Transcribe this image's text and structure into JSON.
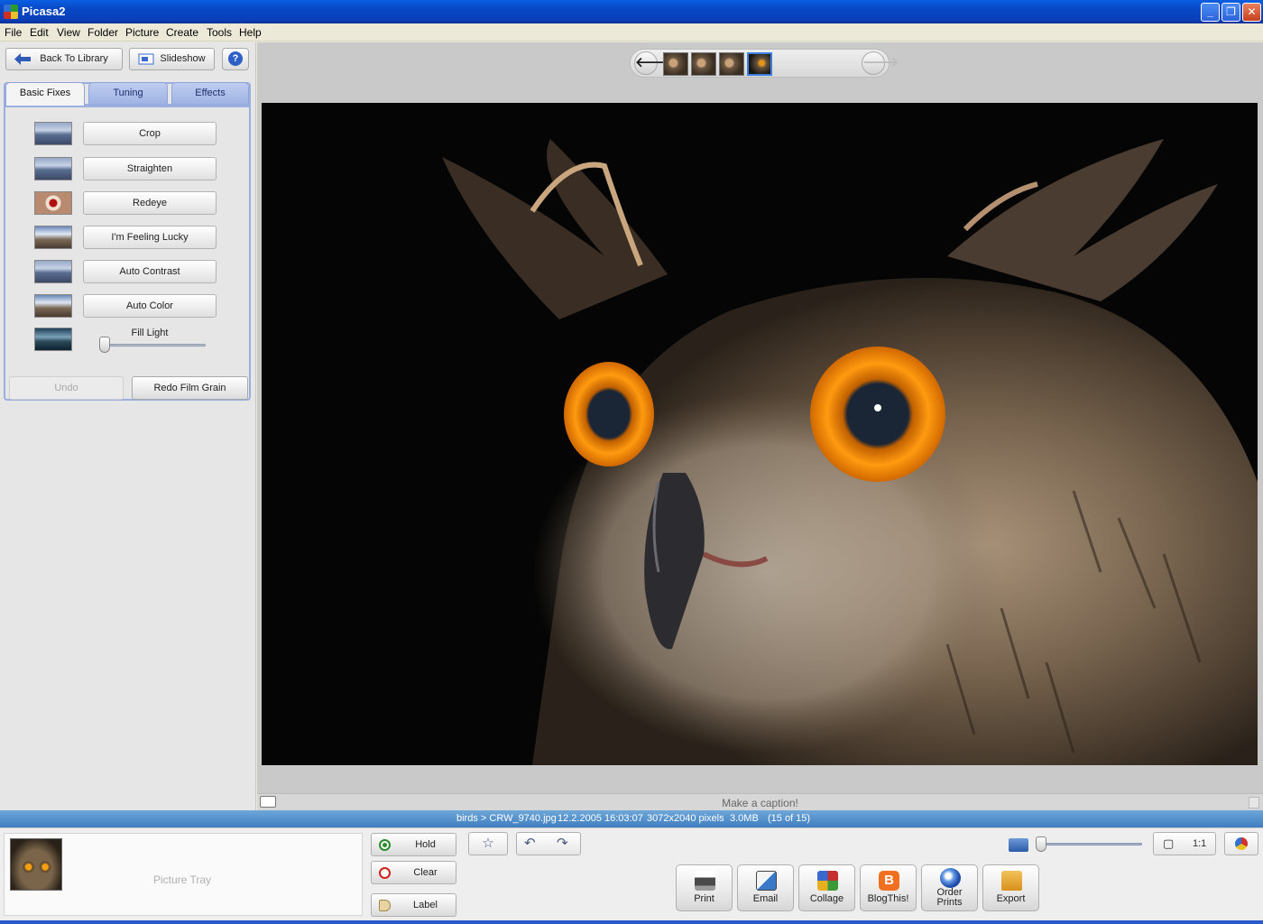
{
  "window": {
    "title": "Picasa2",
    "minimize": "_",
    "restore": "❐",
    "close": "✕"
  },
  "menu": [
    "File",
    "Edit",
    "View",
    "Folder",
    "Picture",
    "Create",
    "Tools",
    "Help"
  ],
  "leftpanel": {
    "back_label": "Back To Library",
    "slideshow_label": "Slideshow",
    "help_label": "?",
    "tabs": [
      "Basic Fixes",
      "Tuning",
      "Effects"
    ],
    "active_tab": "Basic Fixes",
    "fixes": [
      "Crop",
      "Straighten",
      "Redeye",
      "I'm Feeling Lucky",
      "Auto Contrast",
      "Auto Color"
    ],
    "fill_light_label": "Fill Light",
    "fill_light_value": 0,
    "undo_label": "Undo",
    "redo_label": "Redo Film Grain"
  },
  "filmstrip": {
    "prev": "🡐",
    "next": "🡒",
    "thumbnail_count": 4,
    "selected_index": 3
  },
  "caption": {
    "placeholder": "Make a caption!"
  },
  "status": {
    "path": "birds > CRW_9740.jpg",
    "datetime": "12.2.2005 16:03:07",
    "dimensions": "3072x2040 pixels",
    "size": "3.0MB",
    "position": "(15 of 15)"
  },
  "tray": {
    "label": "Picture Tray",
    "hold_label": "Hold",
    "clear_label": "Clear",
    "label_label": "Label"
  },
  "toolbar": {
    "star": "☆",
    "rotate_left": "↶",
    "rotate_right": "↷",
    "fit_label": "▢",
    "actual_size_label": "1:1",
    "zoom_value": 0
  },
  "actions": [
    "Print",
    "Email",
    "Collage",
    "BlogThis!",
    "Order Prints",
    "Export"
  ],
  "colors": {
    "titlebar": "#0a4fd8",
    "status": "#4f8cc8",
    "tab_border": "#9aaee0",
    "accent_eye": "#f08a00"
  }
}
